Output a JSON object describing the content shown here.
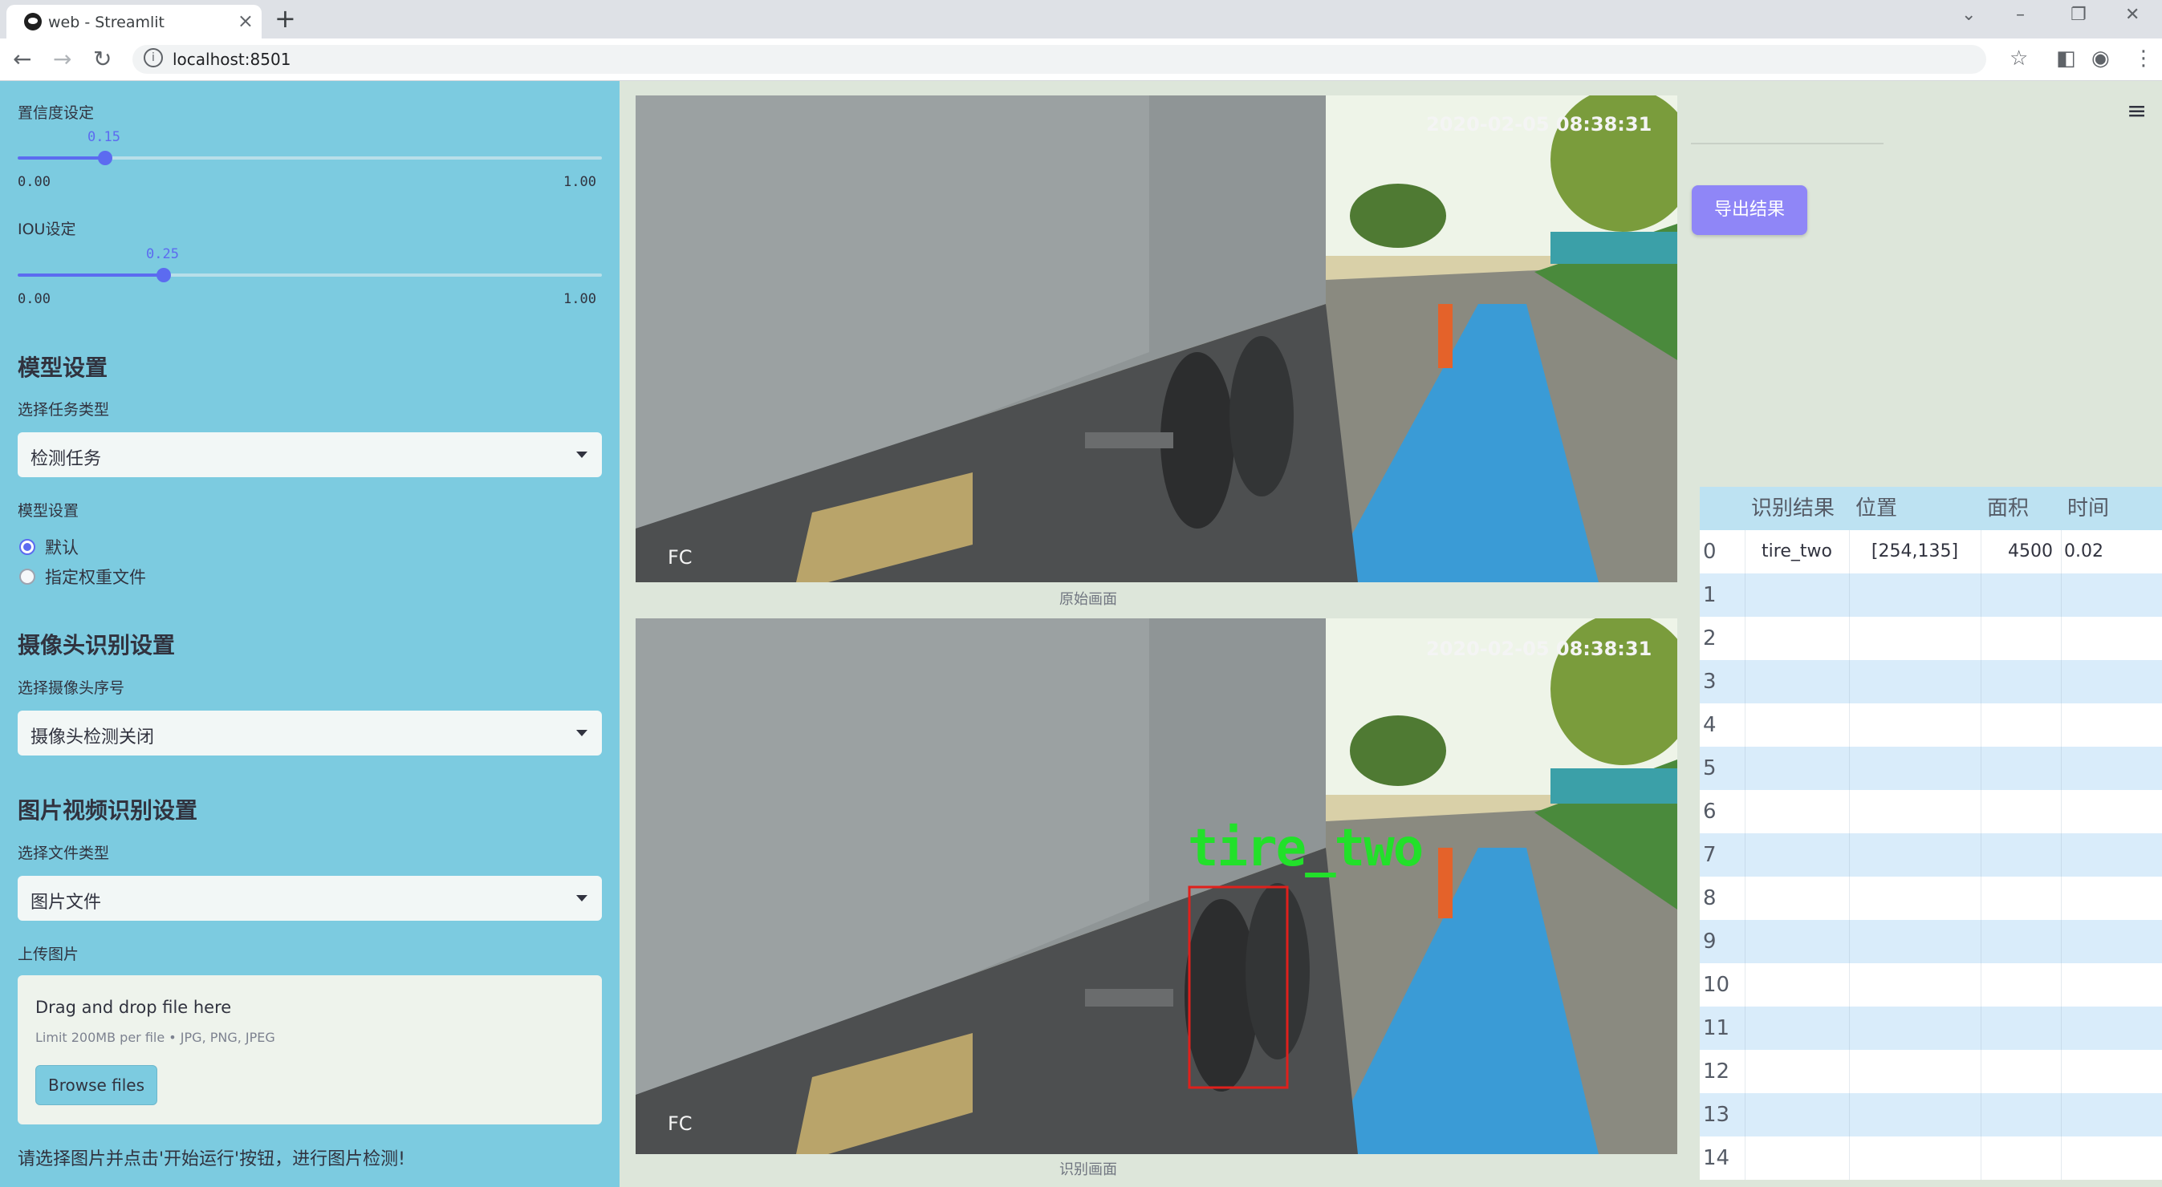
{
  "browser": {
    "tab_title": "web - Streamlit",
    "url": "localhost:8501"
  },
  "sidebar": {
    "confidence": {
      "label": "置信度设定",
      "value": "0.15",
      "level": 0.15,
      "min": "0.00",
      "max": "1.00"
    },
    "iou": {
      "label": "IOU设定",
      "value": "0.25",
      "level": 0.25,
      "min": "0.00",
      "max": "1.00"
    },
    "model_section": {
      "heading": "模型设置",
      "task_label": "选择任务类型",
      "task_value": "检测任务",
      "model_label": "模型设置",
      "options": [
        "默认",
        "指定权重文件"
      ],
      "selected": 0
    },
    "camera_section": {
      "heading": "摄像头识别设置",
      "camera_label": "选择摄像头序号",
      "camera_value": "摄像头检测关闭"
    },
    "file_section": {
      "heading": "图片视频识别设置",
      "type_label": "选择文件类型",
      "type_value": "图片文件",
      "upload_label": "上传图片",
      "drag_text": "Drag and drop file here",
      "limit_text": "Limit 200MB per file • JPG, PNG, JPEG",
      "browse_label": "Browse files"
    },
    "hint": "请选择图片并点击'开始运行'按钮，进行图片检测!"
  },
  "main": {
    "original_caption": "原始画面",
    "result_caption": "识别画面",
    "overlay_timestamp": "2020-02-05 08:38:31",
    "overlay_corner": "FC",
    "detection_label": "tire_two",
    "export_label": "导出结果",
    "table": {
      "headers": [
        "",
        "识别结果",
        "位置",
        "面积",
        "时间"
      ],
      "rows": [
        [
          "0",
          "tire_two",
          "[254,135]",
          "4500",
          "0.02"
        ],
        [
          "1",
          "",
          "",
          "",
          ""
        ],
        [
          "2",
          "",
          "",
          "",
          ""
        ],
        [
          "3",
          "",
          "",
          "",
          ""
        ],
        [
          "4",
          "",
          "",
          "",
          ""
        ],
        [
          "5",
          "",
          "",
          "",
          ""
        ],
        [
          "6",
          "",
          "",
          "",
          ""
        ],
        [
          "7",
          "",
          "",
          "",
          ""
        ],
        [
          "8",
          "",
          "",
          "",
          ""
        ],
        [
          "9",
          "",
          "",
          "",
          ""
        ],
        [
          "10",
          "",
          "",
          "",
          ""
        ],
        [
          "11",
          "",
          "",
          "",
          ""
        ],
        [
          "12",
          "",
          "",
          "",
          ""
        ],
        [
          "13",
          "",
          "",
          "",
          ""
        ],
        [
          "14",
          "",
          "",
          "",
          ""
        ]
      ]
    }
  },
  "colors": {
    "sidebar_bg": "#7ccbe0",
    "main_bg": "#dde6da",
    "accent": "#5c6bf0",
    "export_button": "#8f86f7",
    "detection_box": "#e0201c",
    "detection_text": "#22e02a"
  },
  "icons": [
    "streamlit-favicon",
    "tab-close-icon",
    "new-tab-icon",
    "back-icon",
    "forward-icon",
    "reload-icon",
    "info-icon",
    "star-icon",
    "sidebar-toggle-icon",
    "profile-icon",
    "kebab-menu-icon",
    "hamburger-menu-icon",
    "dropdown-arrow-icon"
  ]
}
